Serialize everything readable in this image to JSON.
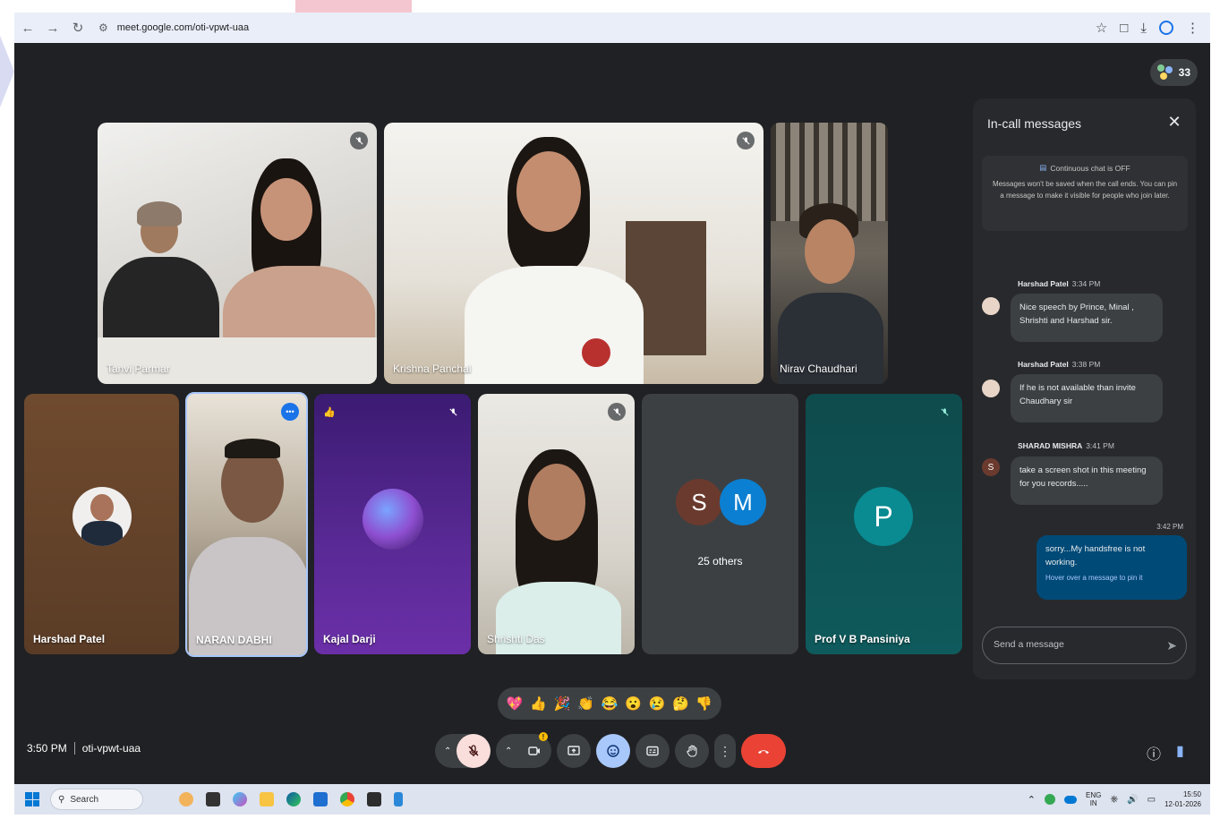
{
  "browser": {
    "url": "meet.google.com/oti-vpwt-uaa"
  },
  "meeting": {
    "participant_count": "33",
    "time": "3:50 PM",
    "code": "oti-vpwt-uaa"
  },
  "tiles": {
    "tanvi": "Tanvi Parmar",
    "krishna": "Krishna Panchal",
    "nirav": "Nirav Chaudhari",
    "harshad": "Harshad Patel",
    "naran": "NARAN DABHI",
    "kajal": "Kajal Darji",
    "shrishti": "Shrishti Das",
    "others_label": "25 others",
    "others_initial_1": "S",
    "others_initial_2": "M",
    "prof": "Prof V B Pansiniya",
    "prof_initial": "P"
  },
  "chat": {
    "title": "In-call messages",
    "notice_title": "Continuous chat is OFF",
    "notice_body": "Messages won't be saved when the call ends. You can pin a message to make it visible for people who join later.",
    "messages": [
      {
        "sender": "Harshad Patel",
        "time": "3:34 PM",
        "text": "Nice speech by Prince, Minal , Shrishti and Harshad sir."
      },
      {
        "sender": "Harshad Patel",
        "time": "3:38 PM",
        "text": "If he is not available than invite Chaudhary sir"
      },
      {
        "sender": "SHARAD MISHRA",
        "time": "3:41 PM",
        "text": "take a screen shot in this meeting for you records.....",
        "initial": "S"
      }
    ],
    "own_time": "3:42 PM",
    "own_text": "sorry...My handsfree is not working.",
    "own_hint": "Hover over a message to pin it",
    "input_placeholder": "Send a message"
  },
  "reactions": [
    "💖",
    "👍",
    "🎉",
    "👏",
    "😂",
    "😮",
    "😢",
    "🤔",
    "👎"
  ],
  "taskbar": {
    "search": "Search",
    "lang_top": "ENG",
    "lang_bottom": "IN",
    "clock_time": "15:50",
    "clock_date": "12-01-2026"
  },
  "colors": {
    "meet_bg": "#202124",
    "end_call": "#ea4335",
    "active_btn": "#a8c7fa",
    "muted_btn": "#f9dedc"
  }
}
